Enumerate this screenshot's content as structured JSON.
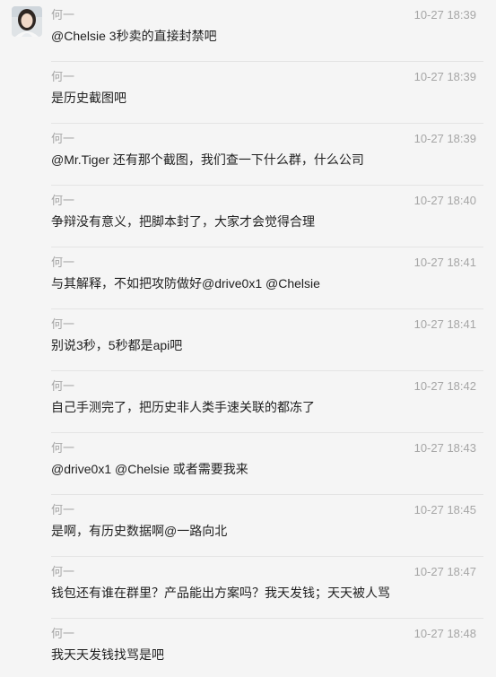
{
  "colors": {
    "background": "#f5f5f5",
    "meta_text": "#a6a6a6",
    "body_text": "#1f1f1f",
    "divider": "#e4e4e4"
  },
  "messages": [
    {
      "sender": "何一",
      "time": "10-27 18:39",
      "text": "@Chelsie 3秒卖的直接封禁吧",
      "avatar": "avatar-photo-icon"
    },
    {
      "sender": "何一",
      "time": "10-27 18:39",
      "text": "是历史截图吧"
    },
    {
      "sender": "何一",
      "time": "10-27 18:39",
      "text": "@Mr.Tiger 还有那个截图，我们查一下什么群，什么公司"
    },
    {
      "sender": "何一",
      "time": "10-27 18:40",
      "text": "争辩没有意义，把脚本封了，大家才会觉得合理"
    },
    {
      "sender": "何一",
      "time": "10-27 18:41",
      "text": "与其解释，不如把攻防做好@drive0x1 @Chelsie"
    },
    {
      "sender": "何一",
      "time": "10-27 18:41",
      "text": "别说3秒，5秒都是api吧"
    },
    {
      "sender": "何一",
      "time": "10-27 18:42",
      "text": "自己手测完了，把历史非人类手速关联的都冻了"
    },
    {
      "sender": "何一",
      "time": "10-27 18:43",
      "text": "@drive0x1 @Chelsie 或者需要我来"
    },
    {
      "sender": "何一",
      "time": "10-27 18:45",
      "text": "是啊，有历史数据啊@一路向北"
    },
    {
      "sender": "何一",
      "time": "10-27 18:47",
      "text": "钱包还有谁在群里？产品能出方案吗？我天发钱；天天被人骂"
    },
    {
      "sender": "何一",
      "time": "10-27 18:48",
      "text": "我天天发钱找骂是吧"
    }
  ]
}
